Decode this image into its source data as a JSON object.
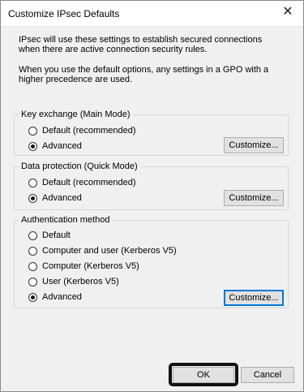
{
  "window": {
    "title": "Customize IPsec Defaults",
    "close_glyph": "✕"
  },
  "intro": {
    "line1": "IPsec will use these settings to establish secured connections",
    "line2": "when there are active connection security rules.",
    "line3": "When you use the default options, any settings in a GPO with a",
    "line4": "higher precedence are used."
  },
  "key_exchange": {
    "legend": "Key exchange (Main Mode)",
    "options": [
      {
        "label": "Default (recommended)",
        "checked": false
      },
      {
        "label": "Advanced",
        "checked": true
      }
    ],
    "customize_label": "Customize..."
  },
  "data_protection": {
    "legend": "Data protection (Quick Mode)",
    "options": [
      {
        "label": "Default (recommended)",
        "checked": false
      },
      {
        "label": "Advanced",
        "checked": true
      }
    ],
    "customize_label": "Customize..."
  },
  "authentication": {
    "legend": "Authentication method",
    "options": [
      {
        "label": "Default",
        "checked": false
      },
      {
        "label": "Computer and user (Kerberos V5)",
        "checked": false
      },
      {
        "label": "Computer (Kerberos V5)",
        "checked": false
      },
      {
        "label": "User (Kerberos V5)",
        "checked": false
      },
      {
        "label": "Advanced",
        "checked": true
      }
    ],
    "customize_label": "Customize..."
  },
  "footer": {
    "ok_label": "OK",
    "cancel_label": "Cancel"
  }
}
